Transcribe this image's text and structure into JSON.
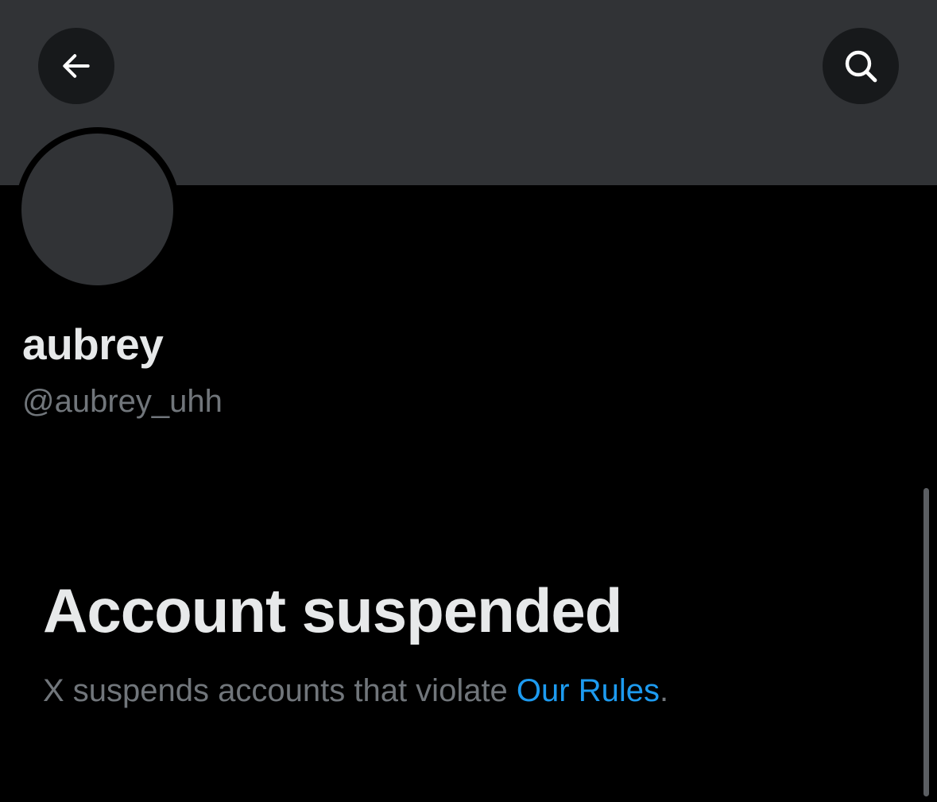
{
  "header": {
    "back_icon": "arrow-left-icon",
    "search_icon": "search-icon",
    "banner_color": "#313336",
    "button_color": "#17191b"
  },
  "profile": {
    "display_name": "aubrey",
    "handle": "@aubrey_uhh",
    "avatar_color": "#313336"
  },
  "suspension": {
    "title": "Account suspended",
    "description": "X suspends accounts that violate ",
    "link_text": "Our Rules",
    "suffix": ".",
    "link_color": "#1d9bf0"
  }
}
